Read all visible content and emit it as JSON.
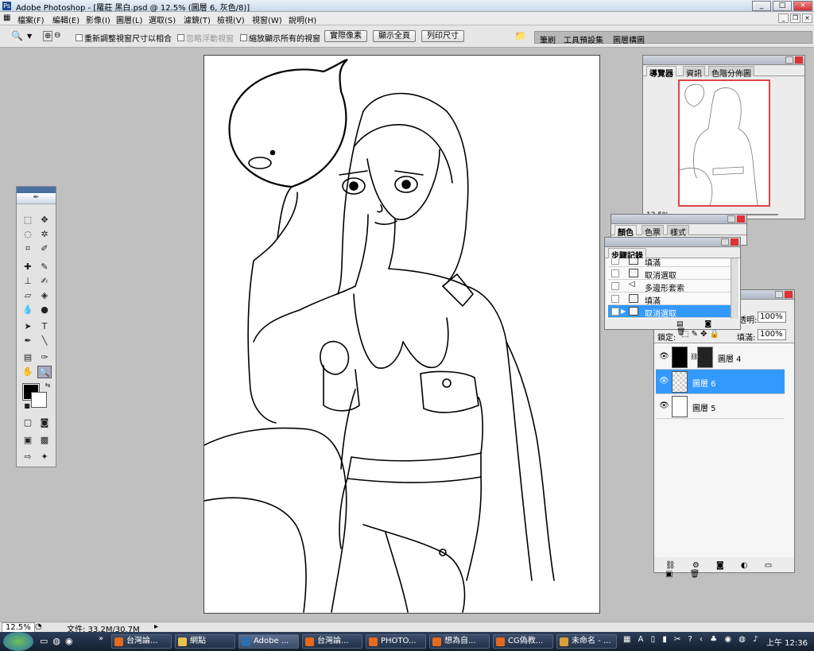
{
  "window": {
    "title": "Adobe Photoshop - [羅莊 黑白.psd @ 12.5% (圖層 6, 灰色/8)]",
    "min": "_",
    "max": "□",
    "close": "×"
  },
  "menu": [
    "檔案(F)",
    "編輯(E)",
    "影像(I)",
    "圖層(L)",
    "選取(S)",
    "濾鏡(T)",
    "檢視(V)",
    "視窗(W)",
    "說明(H)"
  ],
  "options": {
    "chk1": "重新調整視窗尺寸以相合",
    "chk2": "忽略浮動視窗",
    "chk3": "縮放顯示所有的視窗",
    "btn_actual": "實際像素",
    "btn_fit": "顯示全頁",
    "btn_print": "列印尺寸",
    "well_tabs": [
      "筆刷",
      "工具預設集",
      "圖層構圖"
    ]
  },
  "navigator": {
    "tabs": [
      "導覽器",
      "資訊",
      "色階分佈圖"
    ],
    "zoom": "12.5%"
  },
  "color_panel": {
    "tabs": [
      "顏色",
      "色票",
      "樣式"
    ]
  },
  "history": {
    "tab": "步驟記錄",
    "items": [
      "填滿",
      "取消選取",
      "多邊形套索",
      "填滿",
      "取消選取"
    ],
    "selected": 4
  },
  "layers": {
    "opacity_label": "透明:",
    "opacity": "100%",
    "lock_label": "鎖定:",
    "fill_label": "填滿:",
    "fill": "100%",
    "items": [
      "圖層 4",
      "圖層 6",
      "圖層 5"
    ],
    "selected": 1
  },
  "status": {
    "zoom": "12.5%",
    "doc": "文件: 33.2M/30.7M"
  },
  "taskbar": {
    "items": [
      "台灣論...",
      "網點",
      "Adobe ...",
      "台灣論...",
      "PHOTO...",
      "想為自...",
      "CG偽教...",
      "未命名 - ..."
    ],
    "active": 2,
    "clock": "上午 12:36"
  },
  "colors": {
    "selection": "#3399ff",
    "taskbar": "#1c2a40"
  }
}
